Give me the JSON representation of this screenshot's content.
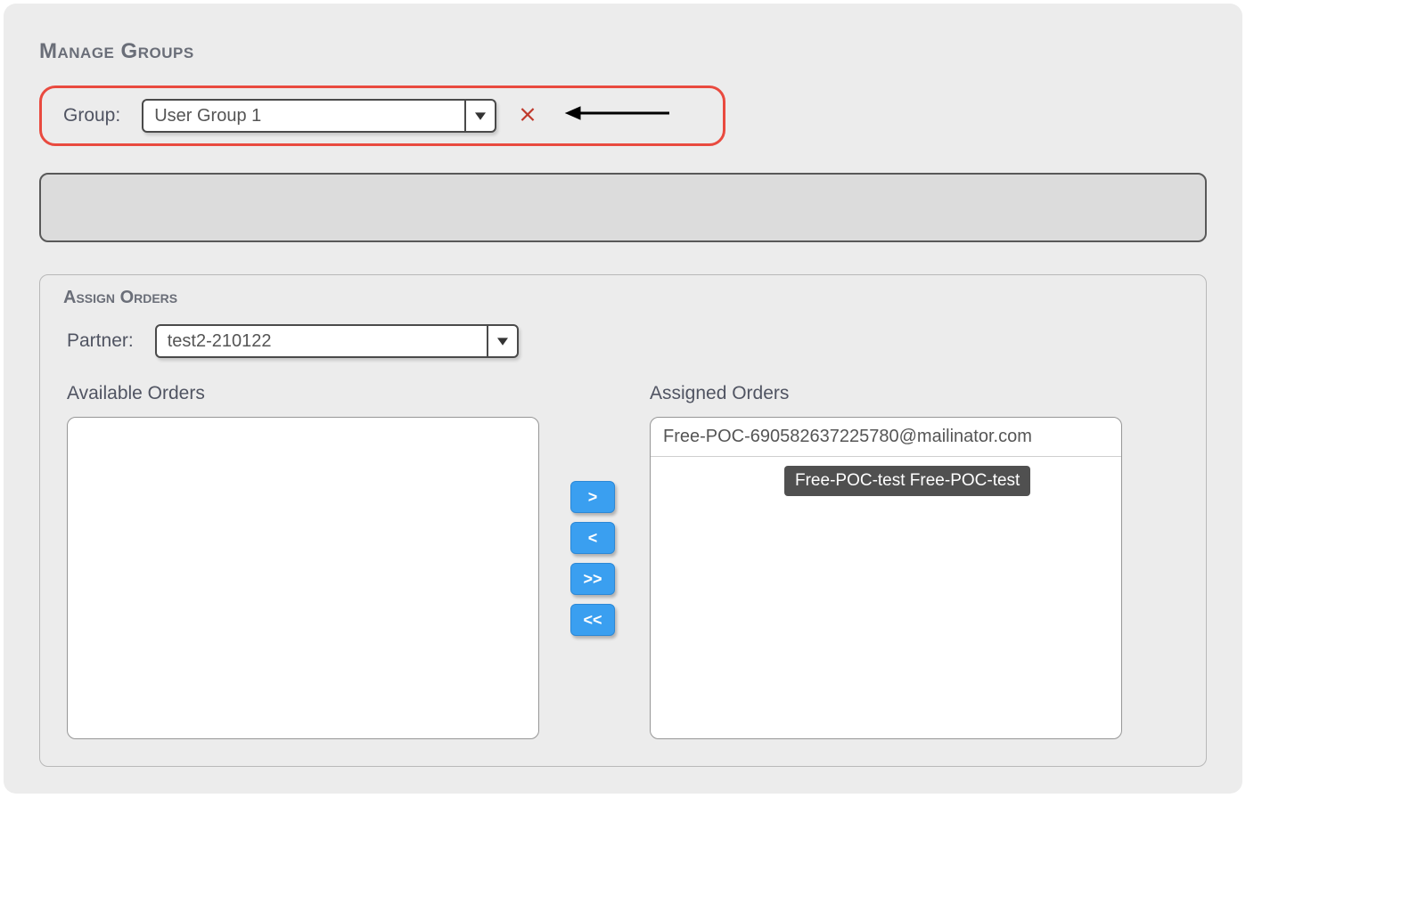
{
  "title": "Manage Groups",
  "group": {
    "label": "Group:",
    "selected": "User Group 1"
  },
  "assign": {
    "title": "Assign Orders",
    "partner_label": "Partner:",
    "partner_selected": "test2-210122",
    "available_label": "Available Orders",
    "assigned_label": "Assigned Orders",
    "available_items": [],
    "assigned_items": [
      "Free-POC-690582637225780@mailinator.com"
    ],
    "tooltip": "Free-POC-test Free-POC-test",
    "buttons": {
      "move_right": ">",
      "move_left": "<",
      "move_all_right": ">>",
      "move_all_left": "<<"
    }
  }
}
